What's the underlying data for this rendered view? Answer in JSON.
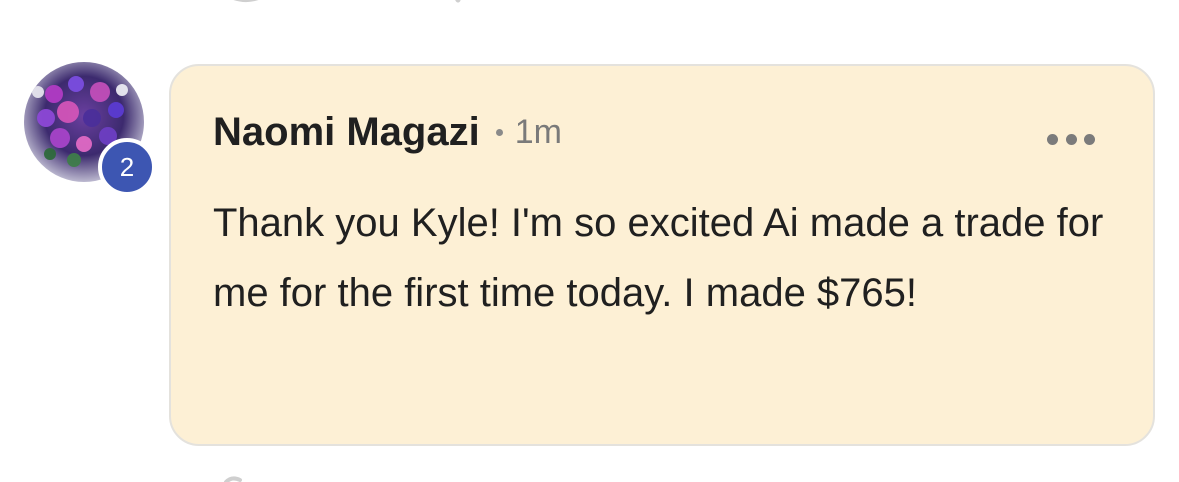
{
  "comment": {
    "author": "Naomi Magazi",
    "time": "1m",
    "text": "Thank you Kyle! I'm so excited Ai made a trade for me for the first time today. I made $765!",
    "badge_count": "2",
    "avatar_icon": "flower-bouquet-photo",
    "more_icon": "more-horizontal-icon"
  },
  "colors": {
    "bubble_background": "#fdf0d5",
    "bubble_border": "#e4e2dd",
    "badge": "#3d56b2",
    "author_text": "#202020",
    "meta_text": "#7a7a7a"
  }
}
